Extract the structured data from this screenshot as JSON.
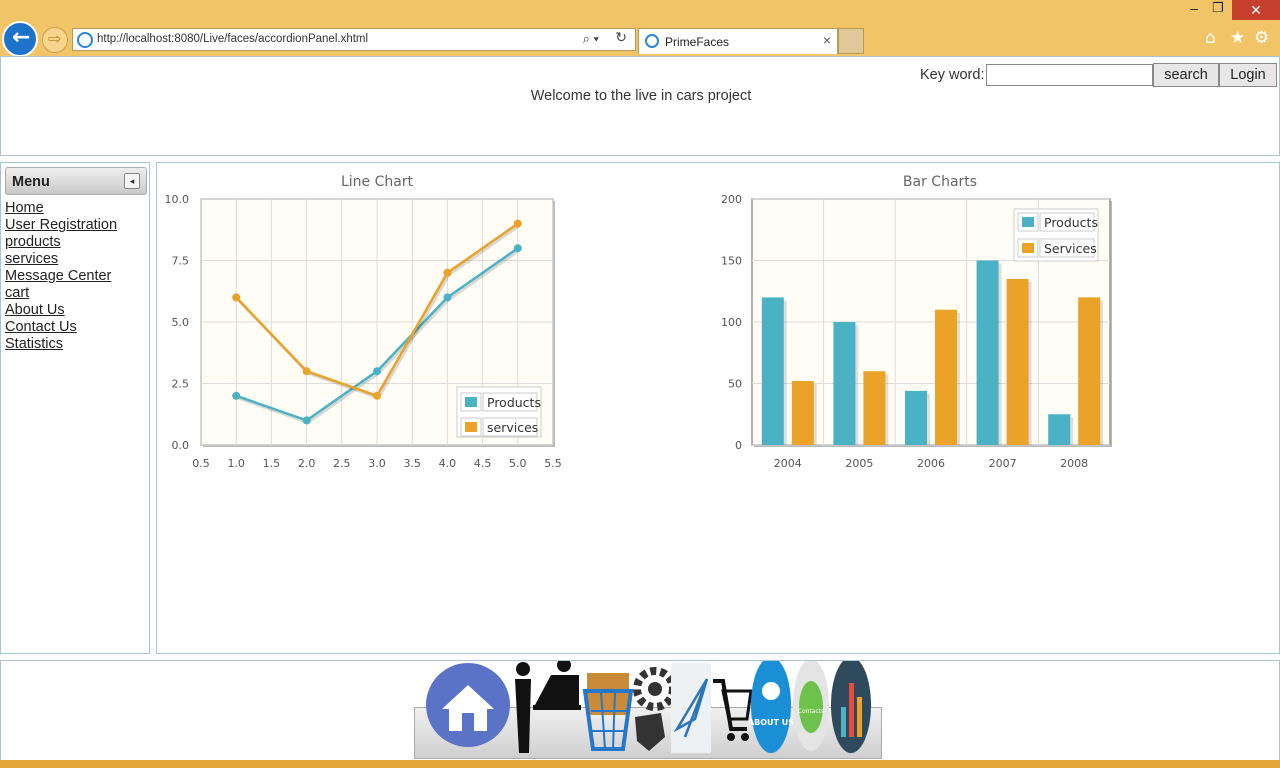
{
  "browser": {
    "url": "http://localhost:8080/Live/faces/accordionPanel.xhtml",
    "tab_title": "PrimeFaces",
    "tab_close": "×",
    "min_glyph": "–",
    "max_glyph": "❐",
    "close_glyph": "✕",
    "search_glyph": "⌕ ▾",
    "refresh_glyph": "↻",
    "back_glyph": "←",
    "forward_glyph": "⇨",
    "home_glyph": "⌂",
    "favorites_glyph": "★",
    "settings_glyph": "⚙"
  },
  "header": {
    "keyword_label": "Key word:",
    "keyword_value": "",
    "search_label": "search",
    "login_label": "Login",
    "welcome": "Welcome to the live in cars project"
  },
  "menu": {
    "title": "Menu",
    "toggle_glyph": "◂",
    "items": [
      {
        "label": "Home"
      },
      {
        "label": "User Registration"
      },
      {
        "label": "products"
      },
      {
        "label": "services"
      },
      {
        "label": "Message Center"
      },
      {
        "label": "cart"
      },
      {
        "label": "About Us"
      },
      {
        "label": "Contact Us"
      },
      {
        "label": "Statistics"
      }
    ]
  },
  "colors": {
    "products": "#4bb2c5",
    "services": "#eaa228"
  },
  "chart_data": [
    {
      "type": "line",
      "title": "Line Chart",
      "xlim": [
        0.5,
        5.5
      ],
      "ylim": [
        0.0,
        10.0
      ],
      "xticks": [
        "0.5",
        "1.0",
        "1.5",
        "2.0",
        "2.5",
        "3.0",
        "3.5",
        "4.0",
        "4.5",
        "5.0",
        "5.5"
      ],
      "yticks": [
        "0.0",
        "2.5",
        "5.0",
        "7.5",
        "10.0"
      ],
      "legend_position": "bottom-right",
      "grid": true,
      "series": [
        {
          "name": "Products",
          "x": [
            1,
            2,
            3,
            4,
            5
          ],
          "values": [
            2,
            1,
            3,
            6,
            8
          ]
        },
        {
          "name": "services",
          "x": [
            1,
            2,
            3,
            4,
            5
          ],
          "values": [
            6,
            3,
            2,
            7,
            9
          ]
        }
      ]
    },
    {
      "type": "bar",
      "title": "Bar Charts",
      "categories": [
        "2004",
        "2005",
        "2006",
        "2007",
        "2008"
      ],
      "ylim": [
        0,
        200
      ],
      "yticks": [
        "0",
        "50",
        "100",
        "150",
        "200"
      ],
      "legend_position": "top-right",
      "grid": true,
      "series": [
        {
          "name": "Products",
          "values": [
            120,
            100,
            44,
            150,
            25
          ]
        },
        {
          "name": "Services",
          "values": [
            52,
            60,
            110,
            135,
            120
          ]
        }
      ]
    }
  ],
  "dock": {
    "items": [
      {
        "icon": "home-icon"
      },
      {
        "icon": "user-registration-icon"
      },
      {
        "icon": "products-icon"
      },
      {
        "icon": "services-icon"
      },
      {
        "icon": "message-center-icon"
      },
      {
        "icon": "cart-icon"
      },
      {
        "icon": "about-us-icon",
        "text": "ABOUT US"
      },
      {
        "icon": "contact-us-icon",
        "text": "Contacts"
      },
      {
        "icon": "statistics-icon"
      }
    ]
  }
}
